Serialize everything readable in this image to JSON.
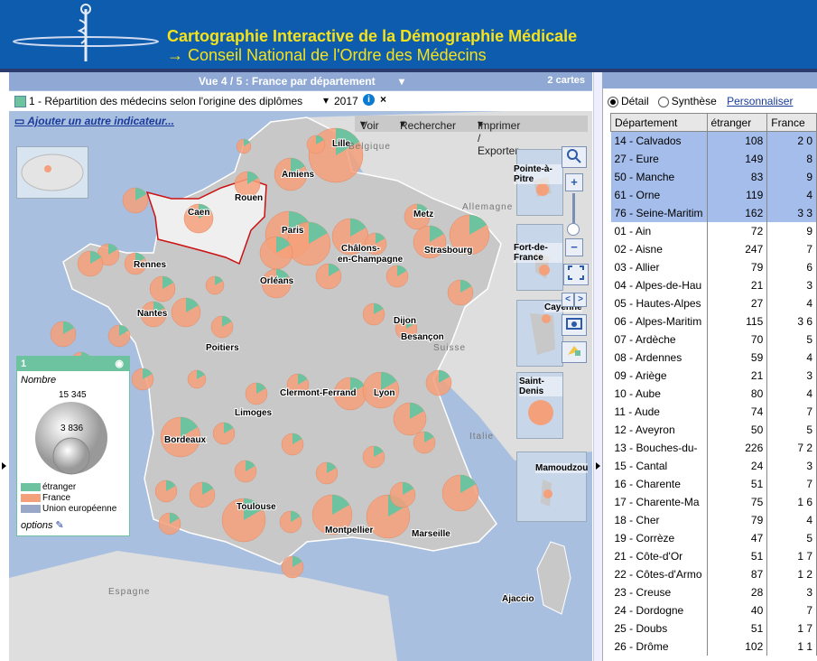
{
  "header": {
    "title": "Cartographie Interactive de la Démographie Médicale",
    "subtitle": "Conseil National de l'Ordre des Médecins",
    "arrow": "→"
  },
  "viewbar": {
    "title": "Vue 4 / 5 : France par département",
    "cards": "2 cartes"
  },
  "indicator": {
    "label": "1 - Répartition des médecins selon l'origine des diplômes",
    "year": "2017",
    "info": "i",
    "close": "×"
  },
  "add_indicator": "Ajouter un autre indicateur...",
  "toolbar": {
    "voir": "Voir",
    "rechercher": "Rechercher",
    "imprimer": "Imprimer / Exporter"
  },
  "colors": {
    "etranger": "#6dc3a0",
    "france": "#f4a07a",
    "ue": "#9aa8c8",
    "selection": "#cc1111"
  },
  "minimaps": [
    "Pointe-à-Pitre",
    "Fort-de-France",
    "Cayenne",
    "Saint-Denis",
    "Mamoudzou"
  ],
  "countries": [
    "Belgique",
    "Allemagne",
    "Suisse",
    "Italie",
    "Espagne"
  ],
  "cities": [
    "Lille",
    "Amiens",
    "Rouen",
    "Caen",
    "Paris",
    "Metz",
    "Strasbourg",
    "Châlons-",
    "en-Champagne",
    "Rennes",
    "Orléans",
    "Nantes",
    "Dijon",
    "Besançon",
    "Poitiers",
    "Limoges",
    "Clermont-Ferrand",
    "Lyon",
    "Bordeaux",
    "Toulouse",
    "Montpellier",
    "Marseille",
    "Ajaccio"
  ],
  "legend": {
    "number": "1",
    "title": "Nombre",
    "max": "15 345",
    "mid": "3 836",
    "items": [
      "étranger",
      "France",
      "Union européenne"
    ],
    "options": "options"
  },
  "right": {
    "detail": "Détail",
    "synthese": "Synthèse",
    "personnaliser": "Personnaliser",
    "columns": [
      "Département",
      "étranger",
      "France"
    ],
    "rows": [
      {
        "dep": "14 - Calvados",
        "etr": "108",
        "fr": "2 0",
        "sel": true
      },
      {
        "dep": "27 - Eure",
        "etr": "149",
        "fr": "8",
        "sel": true
      },
      {
        "dep": "50 - Manche",
        "etr": "83",
        "fr": "9",
        "sel": true
      },
      {
        "dep": "61 - Orne",
        "etr": "119",
        "fr": "4",
        "sel": true
      },
      {
        "dep": "76 - Seine-Maritim",
        "etr": "162",
        "fr": "3 3",
        "sel": true
      },
      {
        "dep": "01 - Ain",
        "etr": "72",
        "fr": "9",
        "sel": false
      },
      {
        "dep": "02 - Aisne",
        "etr": "247",
        "fr": "7",
        "sel": false
      },
      {
        "dep": "03 - Allier",
        "etr": "79",
        "fr": "6",
        "sel": false
      },
      {
        "dep": "04 - Alpes-de-Hau",
        "etr": "21",
        "fr": "3",
        "sel": false
      },
      {
        "dep": "05 - Hautes-Alpes",
        "etr": "27",
        "fr": "4",
        "sel": false
      },
      {
        "dep": "06 - Alpes-Maritim",
        "etr": "115",
        "fr": "3 6",
        "sel": false
      },
      {
        "dep": "07 - Ardèche",
        "etr": "70",
        "fr": "5",
        "sel": false
      },
      {
        "dep": "08 - Ardennes",
        "etr": "59",
        "fr": "4",
        "sel": false
      },
      {
        "dep": "09 - Ariège",
        "etr": "21",
        "fr": "3",
        "sel": false
      },
      {
        "dep": "10 - Aube",
        "etr": "80",
        "fr": "4",
        "sel": false
      },
      {
        "dep": "11 - Aude",
        "etr": "74",
        "fr": "7",
        "sel": false
      },
      {
        "dep": "12 - Aveyron",
        "etr": "50",
        "fr": "5",
        "sel": false
      },
      {
        "dep": "13 - Bouches-du-",
        "etr": "226",
        "fr": "7 2",
        "sel": false
      },
      {
        "dep": "15 - Cantal",
        "etr": "24",
        "fr": "3",
        "sel": false
      },
      {
        "dep": "16 - Charente",
        "etr": "51",
        "fr": "7",
        "sel": false
      },
      {
        "dep": "17 - Charente-Ma",
        "etr": "75",
        "fr": "1 6",
        "sel": false
      },
      {
        "dep": "18 - Cher",
        "etr": "79",
        "fr": "4",
        "sel": false
      },
      {
        "dep": "19 - Corrèze",
        "etr": "47",
        "fr": "5",
        "sel": false
      },
      {
        "dep": "21 - Côte-d'Or",
        "etr": "51",
        "fr": "1 7",
        "sel": false
      },
      {
        "dep": "22 - Côtes-d'Armo",
        "etr": "87",
        "fr": "1 2",
        "sel": false
      },
      {
        "dep": "23 - Creuse",
        "etr": "28",
        "fr": "3",
        "sel": false
      },
      {
        "dep": "24 - Dordogne",
        "etr": "40",
        "fr": "7",
        "sel": false
      },
      {
        "dep": "25 - Doubs",
        "etr": "51",
        "fr": "1 7",
        "sel": false
      },
      {
        "dep": "26 - Drôme",
        "etr": "102",
        "fr": "1 1",
        "sel": false
      }
    ]
  }
}
